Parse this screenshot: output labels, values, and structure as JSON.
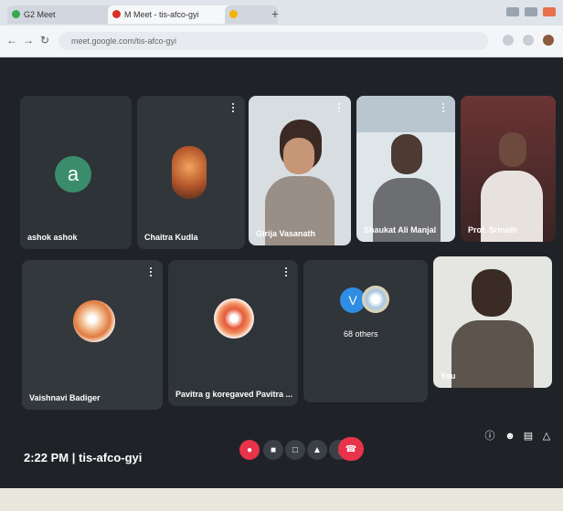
{
  "browser": {
    "tabs": [
      {
        "label": "G2 Meet"
      },
      {
        "label": "M Meet - tis-afco-gyi"
      },
      {
        "label": "+"
      }
    ],
    "url": "meet.google.com/tis-afco-gyi"
  },
  "meeting": {
    "tiles": [
      {
        "name": "ashok ashok",
        "avatar_letter": "a",
        "avatar_color": "#3a8d6b"
      },
      {
        "name": "Chaitra Kudla"
      },
      {
        "name": "Girija Vasanath"
      },
      {
        "name": "Shaukat Ali Manjal"
      },
      {
        "name": "Prof. Srinath"
      },
      {
        "name": "Vaishnavi Badiger"
      },
      {
        "name": "Pavitra g koregaved Pavitra ..."
      },
      {
        "name": "68 others",
        "avatar_letter": "V",
        "avatar_color": "#2f8de4"
      },
      {
        "name": "You"
      }
    ],
    "time": "2:22 PM",
    "meeting_code": "tis-afco-gyi",
    "separator": "|"
  },
  "colors": {
    "end_call": "#e8334a",
    "control_bg": "#3b4046"
  }
}
